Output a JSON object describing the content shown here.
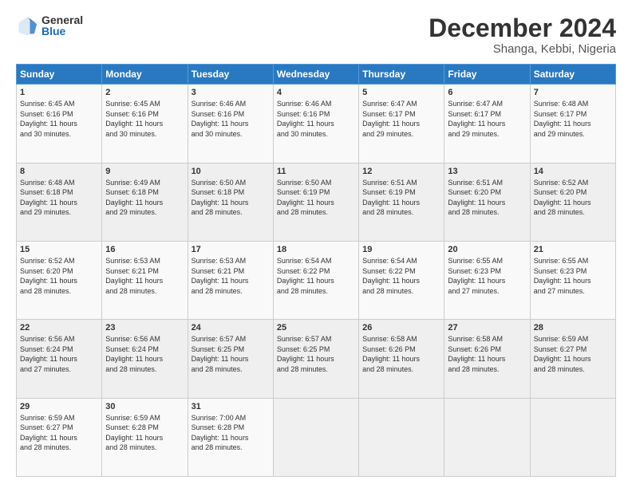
{
  "logo": {
    "general": "General",
    "blue": "Blue"
  },
  "title": "December 2024",
  "subtitle": "Shanga, Kebbi, Nigeria",
  "days_of_week": [
    "Sunday",
    "Monday",
    "Tuesday",
    "Wednesday",
    "Thursday",
    "Friday",
    "Saturday"
  ],
  "weeks": [
    [
      {
        "day": "1",
        "info": "Sunrise: 6:45 AM\nSunset: 6:16 PM\nDaylight: 11 hours\nand 30 minutes."
      },
      {
        "day": "2",
        "info": "Sunrise: 6:45 AM\nSunset: 6:16 PM\nDaylight: 11 hours\nand 30 minutes."
      },
      {
        "day": "3",
        "info": "Sunrise: 6:46 AM\nSunset: 6:16 PM\nDaylight: 11 hours\nand 30 minutes."
      },
      {
        "day": "4",
        "info": "Sunrise: 6:46 AM\nSunset: 6:16 PM\nDaylight: 11 hours\nand 30 minutes."
      },
      {
        "day": "5",
        "info": "Sunrise: 6:47 AM\nSunset: 6:17 PM\nDaylight: 11 hours\nand 29 minutes."
      },
      {
        "day": "6",
        "info": "Sunrise: 6:47 AM\nSunset: 6:17 PM\nDaylight: 11 hours\nand 29 minutes."
      },
      {
        "day": "7",
        "info": "Sunrise: 6:48 AM\nSunset: 6:17 PM\nDaylight: 11 hours\nand 29 minutes."
      }
    ],
    [
      {
        "day": "8",
        "info": "Sunrise: 6:48 AM\nSunset: 6:18 PM\nDaylight: 11 hours\nand 29 minutes."
      },
      {
        "day": "9",
        "info": "Sunrise: 6:49 AM\nSunset: 6:18 PM\nDaylight: 11 hours\nand 29 minutes."
      },
      {
        "day": "10",
        "info": "Sunrise: 6:50 AM\nSunset: 6:18 PM\nDaylight: 11 hours\nand 28 minutes."
      },
      {
        "day": "11",
        "info": "Sunrise: 6:50 AM\nSunset: 6:19 PM\nDaylight: 11 hours\nand 28 minutes."
      },
      {
        "day": "12",
        "info": "Sunrise: 6:51 AM\nSunset: 6:19 PM\nDaylight: 11 hours\nand 28 minutes."
      },
      {
        "day": "13",
        "info": "Sunrise: 6:51 AM\nSunset: 6:20 PM\nDaylight: 11 hours\nand 28 minutes."
      },
      {
        "day": "14",
        "info": "Sunrise: 6:52 AM\nSunset: 6:20 PM\nDaylight: 11 hours\nand 28 minutes."
      }
    ],
    [
      {
        "day": "15",
        "info": "Sunrise: 6:52 AM\nSunset: 6:20 PM\nDaylight: 11 hours\nand 28 minutes."
      },
      {
        "day": "16",
        "info": "Sunrise: 6:53 AM\nSunset: 6:21 PM\nDaylight: 11 hours\nand 28 minutes."
      },
      {
        "day": "17",
        "info": "Sunrise: 6:53 AM\nSunset: 6:21 PM\nDaylight: 11 hours\nand 28 minutes."
      },
      {
        "day": "18",
        "info": "Sunrise: 6:54 AM\nSunset: 6:22 PM\nDaylight: 11 hours\nand 28 minutes."
      },
      {
        "day": "19",
        "info": "Sunrise: 6:54 AM\nSunset: 6:22 PM\nDaylight: 11 hours\nand 28 minutes."
      },
      {
        "day": "20",
        "info": "Sunrise: 6:55 AM\nSunset: 6:23 PM\nDaylight: 11 hours\nand 27 minutes."
      },
      {
        "day": "21",
        "info": "Sunrise: 6:55 AM\nSunset: 6:23 PM\nDaylight: 11 hours\nand 27 minutes."
      }
    ],
    [
      {
        "day": "22",
        "info": "Sunrise: 6:56 AM\nSunset: 6:24 PM\nDaylight: 11 hours\nand 27 minutes."
      },
      {
        "day": "23",
        "info": "Sunrise: 6:56 AM\nSunset: 6:24 PM\nDaylight: 11 hours\nand 28 minutes."
      },
      {
        "day": "24",
        "info": "Sunrise: 6:57 AM\nSunset: 6:25 PM\nDaylight: 11 hours\nand 28 minutes."
      },
      {
        "day": "25",
        "info": "Sunrise: 6:57 AM\nSunset: 6:25 PM\nDaylight: 11 hours\nand 28 minutes."
      },
      {
        "day": "26",
        "info": "Sunrise: 6:58 AM\nSunset: 6:26 PM\nDaylight: 11 hours\nand 28 minutes."
      },
      {
        "day": "27",
        "info": "Sunrise: 6:58 AM\nSunset: 6:26 PM\nDaylight: 11 hours\nand 28 minutes."
      },
      {
        "day": "28",
        "info": "Sunrise: 6:59 AM\nSunset: 6:27 PM\nDaylight: 11 hours\nand 28 minutes."
      }
    ],
    [
      {
        "day": "29",
        "info": "Sunrise: 6:59 AM\nSunset: 6:27 PM\nDaylight: 11 hours\nand 28 minutes."
      },
      {
        "day": "30",
        "info": "Sunrise: 6:59 AM\nSunset: 6:28 PM\nDaylight: 11 hours\nand 28 minutes."
      },
      {
        "day": "31",
        "info": "Sunrise: 7:00 AM\nSunset: 6:28 PM\nDaylight: 11 hours\nand 28 minutes."
      },
      null,
      null,
      null,
      null
    ]
  ]
}
